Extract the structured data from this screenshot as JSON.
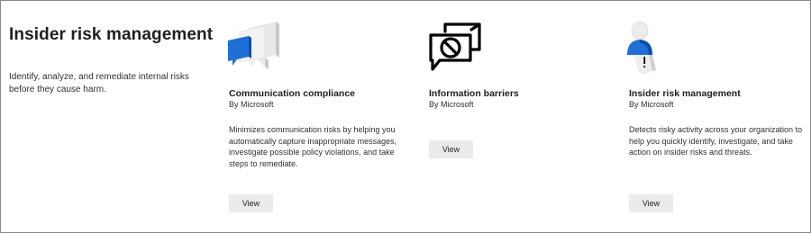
{
  "section": {
    "title": "Insider risk management",
    "description": "Identify, analyze, and remediate internal risks before they cause harm."
  },
  "cards": [
    {
      "icon": "chat-bubbles-icon",
      "title": "Communication compliance",
      "vendor": "By Microsoft",
      "description": "Minimizes communication risks by helping you automatically capture inappropriate messages, investigate possible policy violations, and take steps to remediate.",
      "button_label": "View"
    },
    {
      "icon": "blocked-conversation-icon",
      "title": "Information barriers",
      "vendor": "By Microsoft",
      "description": "",
      "button_label": "View"
    },
    {
      "icon": "person-alert-icon",
      "title": "Insider risk management",
      "vendor": "By Microsoft",
      "description": "Detects risky activity across your organization to help you quickly identify, investigate, and take action on insider risks and threats.",
      "button_label": "View"
    }
  ],
  "colors": {
    "accent_blue": "#0f6cbd",
    "button_bg": "#edebe9",
    "text": "#323130"
  }
}
